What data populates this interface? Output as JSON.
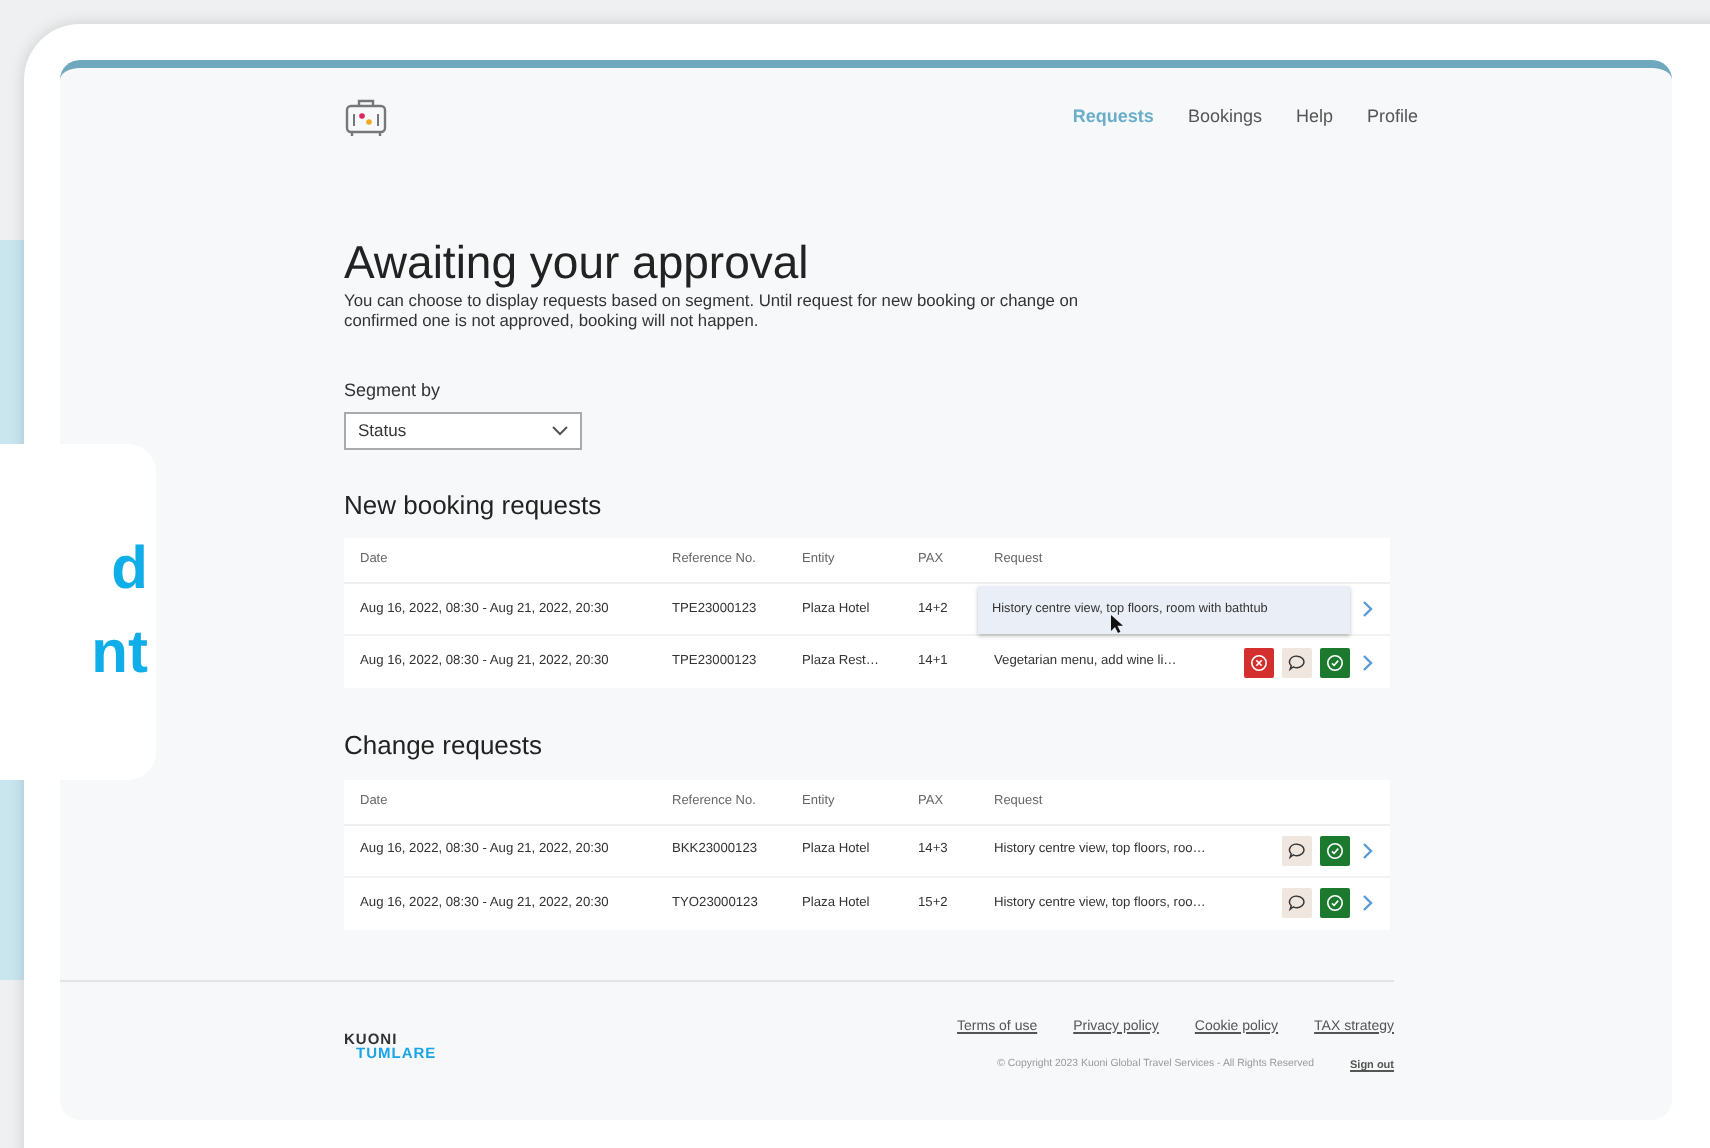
{
  "side_card": {
    "lines": [
      "d",
      "nt"
    ]
  },
  "nav": [
    {
      "label": "Requests",
      "selected": true
    },
    {
      "label": "Bookings",
      "selected": false
    },
    {
      "label": "Help",
      "selected": false
    },
    {
      "label": "Profile",
      "selected": false
    }
  ],
  "title": "Awaiting your approval",
  "description": "You can choose to display requests based on segment. Until request for new booking or change on confirmed one is not approved, booking will not happen.",
  "segment": {
    "label": "Segment by",
    "value": "Status"
  },
  "sections": [
    {
      "title": "New booking requests",
      "columns": [
        "Date",
        "Reference No.",
        "Entity",
        "PAX",
        "Request"
      ],
      "rows": [
        {
          "date": "Aug 16, 2022, 08:30 - Aug 21, 2022, 20:30",
          "reference": "TPE23000123",
          "entity": "Plaza Hotel",
          "pax": "14+2",
          "request": "History centre view, top floors, room with bathtub",
          "hovered": true
        },
        {
          "date": "Aug 16, 2022, 08:30 - Aug 21, 2022, 20:30",
          "reference": "TPE23000123",
          "entity": "Plaza Rest…",
          "pax": "14+1",
          "request": "Vegetarian menu, add wine li…",
          "hovered": false,
          "actions": [
            {
              "kind": "reject"
            },
            {
              "kind": "comment"
            },
            {
              "kind": "approve"
            }
          ]
        }
      ]
    },
    {
      "title": "Change requests",
      "columns": [
        "Date",
        "Reference No.",
        "Entity",
        "PAX",
        "Request"
      ],
      "rows": [
        {
          "date": "Aug 16, 2022, 08:30 - Aug 21, 2022, 20:30",
          "reference": "BKK23000123",
          "entity": "Plaza Hotel",
          "pax": "14+3",
          "request": "History centre view, top floors, roo…",
          "hovered": false,
          "actions": [
            {
              "kind": "comment"
            },
            {
              "kind": "approve"
            }
          ]
        },
        {
          "date": "Aug 16, 2022, 08:30 - Aug 21, 2022, 20:30",
          "reference": "TYO23000123",
          "entity": "Plaza Hotel",
          "pax": "15+2",
          "request": "History centre view, top floors, roo…",
          "hovered": false,
          "actions": [
            {
              "kind": "comment"
            },
            {
              "kind": "approve"
            }
          ]
        }
      ]
    }
  ],
  "footer": {
    "logo": [
      "KUONI",
      "TUMLARE"
    ],
    "links": [
      "Terms of use",
      "Privacy policy",
      "Cookie policy",
      "TAX strategy"
    ],
    "copyright": "© Copyright 2023 Kuoni Global Travel Services - All Rights Reserved",
    "sign_out": "Sign out"
  }
}
